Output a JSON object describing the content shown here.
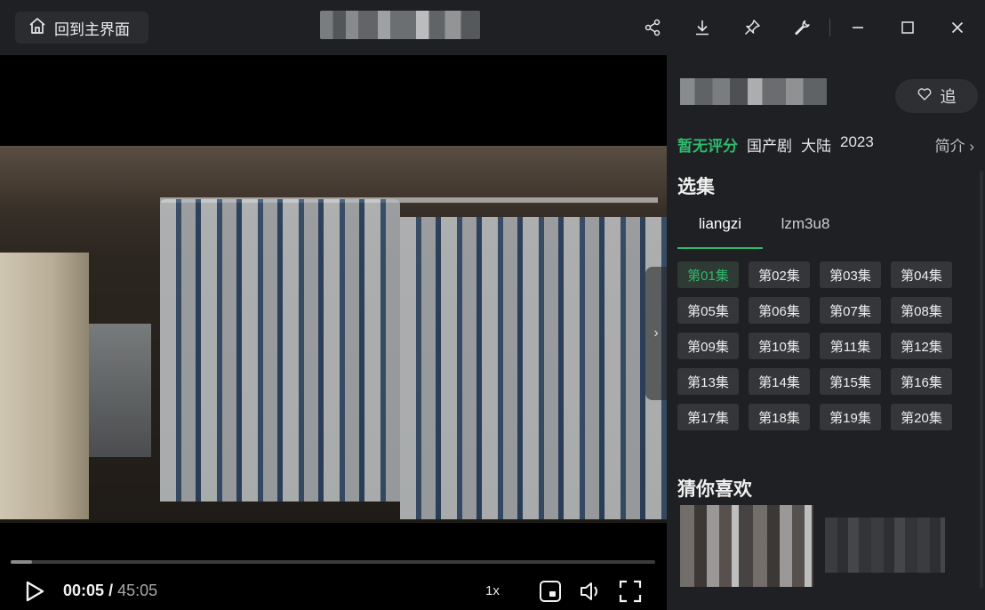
{
  "titlebar": {
    "home_label": "回到主界面",
    "icons": [
      "share-icon",
      "download-icon",
      "pin-icon",
      "wrench-icon",
      "minimize-icon",
      "maximize-icon",
      "close-icon"
    ]
  },
  "player": {
    "current_time": "00:05",
    "separator": "/",
    "duration": "45:05",
    "speed": "1x",
    "progress_fraction": 0.033
  },
  "panel": {
    "follow_label": "追",
    "score_text": "暂无评分",
    "genre": "国产剧",
    "region": "大陆",
    "year": "2023",
    "intro_label": "简介",
    "episodes_heading": "选集",
    "sources": [
      {
        "label": "liangzi",
        "active": true
      },
      {
        "label": "lzm3u8",
        "active": false
      }
    ],
    "episodes": [
      "第01集",
      "第02集",
      "第03集",
      "第04集",
      "第05集",
      "第06集",
      "第07集",
      "第08集",
      "第09集",
      "第10集",
      "第11集",
      "第12集",
      "第13集",
      "第14集",
      "第15集",
      "第16集",
      "第17集",
      "第18集",
      "第19集",
      "第20集"
    ],
    "active_episode": 0,
    "recommend_heading": "猜你喜欢"
  },
  "colors": {
    "accent": "#2fb96d",
    "panel_bg": "#1f2023",
    "button_bg": "#35363a"
  }
}
